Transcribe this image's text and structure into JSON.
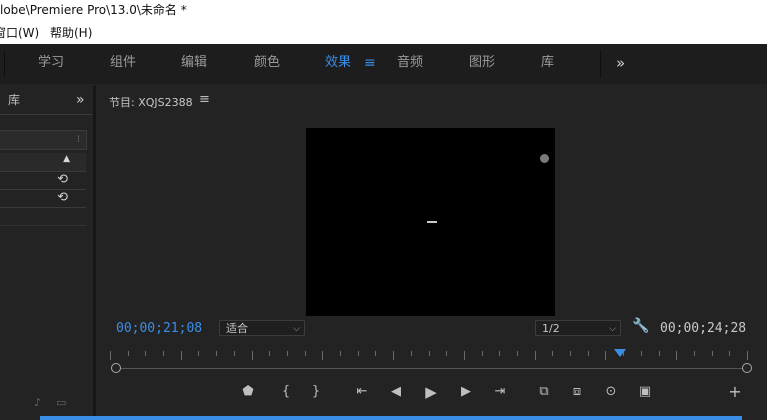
{
  "titlebar": {
    "title": "lobe\\Premiere Pro\\13.0\\未命名 *"
  },
  "menubar": {
    "items": [
      "窗口(W)",
      "帮助(H)"
    ]
  },
  "workspaces": {
    "tabs": [
      "学习",
      "组件",
      "编辑",
      "颜色",
      "效果",
      "音频",
      "图形",
      "库"
    ],
    "active": "效果",
    "menu_icon": "hamburger-icon",
    "overflow_icon": "double-chevron-right-icon"
  },
  "left_panel": {
    "title": "库",
    "overflow_icon": "double-chevron-right-icon"
  },
  "program_monitor": {
    "title": "节目: XQJS2388",
    "menu_icon": "hamburger-icon",
    "current_timecode": "00;00;21;08",
    "fit_select": "适合",
    "resolution_select": "1/2",
    "duration_timecode": "00;00;24;28",
    "settings_icon": "wrench-icon",
    "playhead_position": 0.8
  },
  "colors": {
    "accent": "#3a8ee6",
    "timecode": "#3a8ee6",
    "panel_bg": "#232323",
    "header_bg": "#1d1d1d"
  },
  "transport": {
    "icons": [
      "add-marker-icon",
      "mark-in-icon",
      "mark-out-icon",
      "go-to-in-icon",
      "step-back-icon",
      "play-icon",
      "step-forward-icon",
      "go-to-out-icon",
      "insert-icon",
      "overwrite-icon",
      "export-frame-icon",
      "compare-icon",
      "add-button-icon"
    ]
  }
}
